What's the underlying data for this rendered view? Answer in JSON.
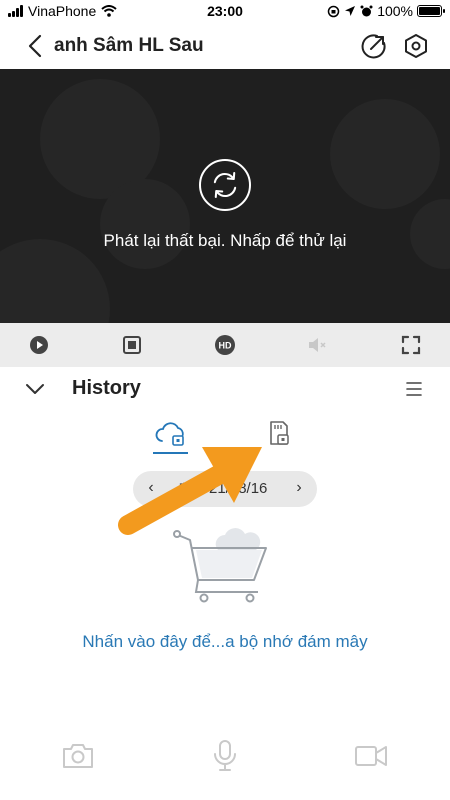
{
  "status_bar": {
    "carrier": "VinaPhone",
    "time": "23:00",
    "battery": "100%",
    "battery_level": 1.0
  },
  "nav": {
    "title": "anh Sâm HL Sau",
    "back_icon": "back-chevron-icon",
    "share_icon": "share-external-icon",
    "settings_icon": "settings-hexagon-icon"
  },
  "player": {
    "error_message": "Phát lại thất bại. Nhấp để thử lại",
    "retry_icon": "refresh-icon"
  },
  "controls": {
    "items": [
      "play-icon",
      "stop-icon",
      "hd-icon",
      "mute-icon",
      "fullscreen-icon"
    ],
    "hd_label": "HD"
  },
  "history": {
    "title": "History",
    "collapse_icon": "chevron-down-icon",
    "menu_icon": "menu-icon",
    "tabs": [
      {
        "name": "cloud-storage-tab",
        "icon": "cloud-lock-icon",
        "active": true
      },
      {
        "name": "sd-card-tab",
        "icon": "sd-card-icon",
        "active": false
      }
    ],
    "date": "21/08/16",
    "prev_label": "‹",
    "next_label": "›",
    "empty_illustration": "empty-cart-icon",
    "cloud_link": "Nhấn vào đây để...a bộ nhớ đám mây"
  },
  "bottom_bar": {
    "items": [
      "camera-icon",
      "microphone-icon",
      "video-record-icon"
    ]
  },
  "colors": {
    "accent": "#2477b8",
    "link": "#2a79b5",
    "player_bg": "#1f1f1f",
    "controls_bg": "#ececec",
    "annotation_arrow": "#f39a1e"
  }
}
